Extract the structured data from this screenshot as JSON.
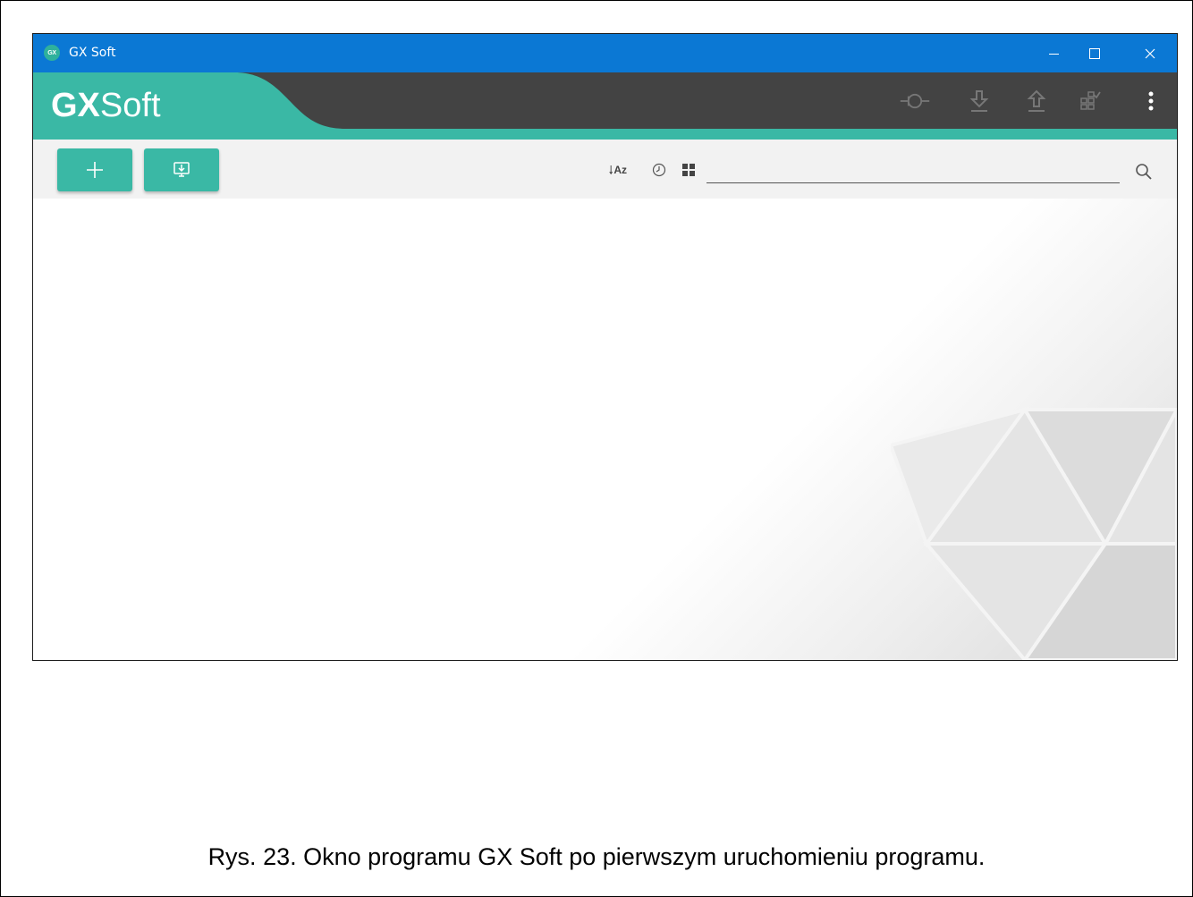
{
  "window": {
    "app_icon_text": "GX",
    "title": "GX Soft"
  },
  "header": {
    "logo_bold": "GX",
    "logo_regular": "Soft",
    "icons": [
      "connect-icon",
      "download-icon",
      "upload-icon",
      "grid-check-icon",
      "more-vert-icon"
    ]
  },
  "toolbar": {
    "add_icon": "plus-icon",
    "import_icon": "import-icon",
    "sort_label": "Az",
    "search_value": "",
    "search_placeholder": ""
  },
  "caption": "Rys. 23. Okno programu GX Soft po pierwszym uruchomieniu programu.",
  "colors": {
    "titlebar": "#0b78d4",
    "header": "#434343",
    "accent": "#3ab8a5",
    "toolbar": "#f2f2f2"
  }
}
